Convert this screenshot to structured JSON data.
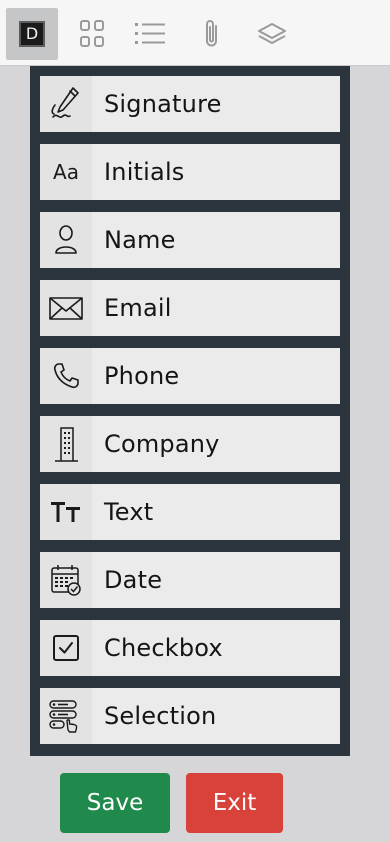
{
  "toolbar": {
    "active_letter": "D",
    "buttons": [
      {
        "icon": "d-box-icon"
      },
      {
        "icon": "grid-icon"
      },
      {
        "icon": "list-icon"
      },
      {
        "icon": "paperclip-icon"
      },
      {
        "icon": "layers-icon"
      }
    ]
  },
  "fields": [
    {
      "label": "Signature",
      "icon": "signature-pen-icon"
    },
    {
      "label": "Initials",
      "icon": "initials-icon",
      "icon_text": "Aa"
    },
    {
      "label": "Name",
      "icon": "person-icon"
    },
    {
      "label": "Email",
      "icon": "envelope-icon"
    },
    {
      "label": "Phone",
      "icon": "phone-icon"
    },
    {
      "label": "Company",
      "icon": "building-icon"
    },
    {
      "label": "Text",
      "icon": "text-size-icon"
    },
    {
      "label": "Date",
      "icon": "calendar-icon"
    },
    {
      "label": "Checkbox",
      "icon": "checkbox-icon"
    },
    {
      "label": "Selection",
      "icon": "selection-list-icon"
    }
  ],
  "actions": {
    "save_label": "Save",
    "exit_label": "Exit"
  },
  "colors": {
    "panel": "#2c353d",
    "save": "#1f8a4c",
    "exit": "#d9423a"
  }
}
